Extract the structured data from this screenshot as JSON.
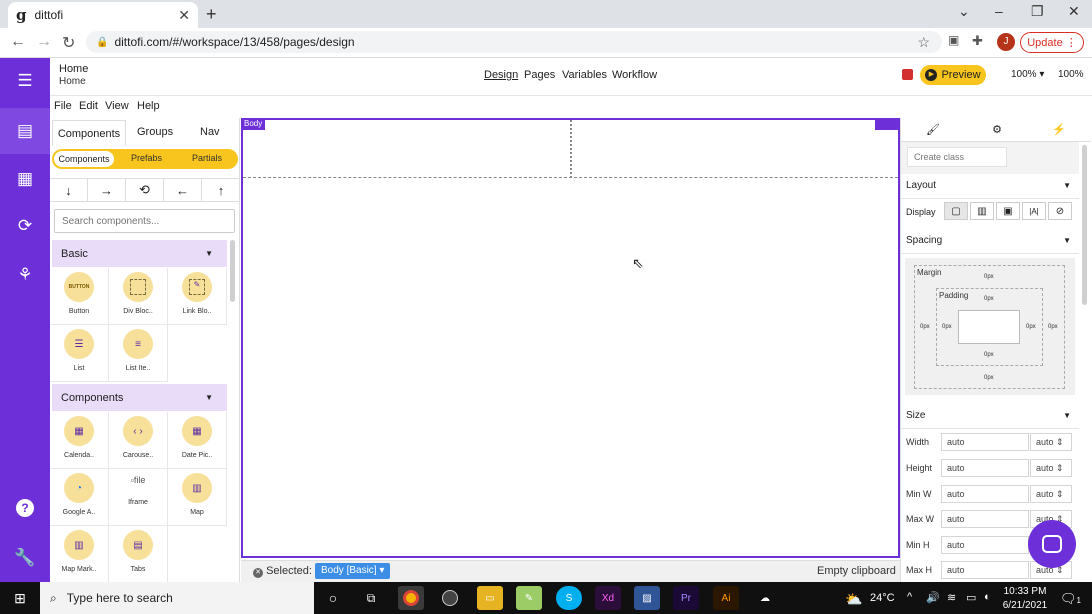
{
  "browser": {
    "tab_title": "dittofi",
    "tab_favicon": "g",
    "url": "dittofi.com/#/workspace/13/458/pages/design",
    "profile_initial": "J",
    "update_label": "Update"
  },
  "app": {
    "breadcrumb_top": "Home",
    "breadcrumb_sub": "Home",
    "nav_tabs": [
      "Design",
      "Pages",
      "Variables",
      "Workflow"
    ],
    "preview_label": "Preview",
    "zoom_select": "100% ▾",
    "zoom_value": "100%",
    "menu": [
      "File",
      "Edit",
      "View",
      "Help"
    ]
  },
  "left_panel": {
    "tabs": [
      "Components",
      "Groups",
      "Nav"
    ],
    "segments": [
      "Components",
      "Prefabs",
      "Partials"
    ],
    "search_placeholder": "Search components...",
    "sections": [
      {
        "title": "Basic",
        "items": [
          "Button",
          "Div Bloc..",
          "Link Blo..",
          "List",
          "List Ite.."
        ]
      },
      {
        "title": "Components",
        "items": [
          "Calenda..",
          "Carouse..",
          "Date Pic..",
          "Google A..",
          "Iframe",
          "Map",
          "Map Mark..",
          "Tabs"
        ]
      }
    ],
    "button_thumb_text": "BUTTON",
    "file_broken_alt": "file"
  },
  "canvas": {
    "body_tag": "Body",
    "selected_label": "Selected:",
    "selected_chip": "Body [Basic]",
    "clipboard_label": "Empty clipboard"
  },
  "right_panel": {
    "create_class_placeholder": "Create class",
    "layout_label": "Layout",
    "display_label": "Display",
    "spacing_label": "Spacing",
    "margin_label": "Margin",
    "padding_label": "Padding",
    "spacing_value": "0px",
    "size_label": "Size",
    "size_rows": [
      {
        "label": "Width",
        "value": "auto",
        "unit": "auto"
      },
      {
        "label": "Height",
        "value": "auto",
        "unit": "auto"
      },
      {
        "label": "Min W",
        "value": "auto",
        "unit": "auto"
      },
      {
        "label": "Max W",
        "value": "auto",
        "unit": "auto"
      },
      {
        "label": "Min H",
        "value": "auto",
        "unit": "auto"
      },
      {
        "label": "Max H",
        "value": "auto",
        "unit": "auto"
      }
    ]
  },
  "taskbar": {
    "search_placeholder": "Type here to search",
    "temperature": "24°C",
    "time": "10:33 PM",
    "date": "6/21/2021",
    "notification_count": "1"
  },
  "colors": {
    "brand_purple": "#6c2fd8",
    "accent_yellow": "#f7c51d",
    "selection_blue": "#3b8de6"
  }
}
